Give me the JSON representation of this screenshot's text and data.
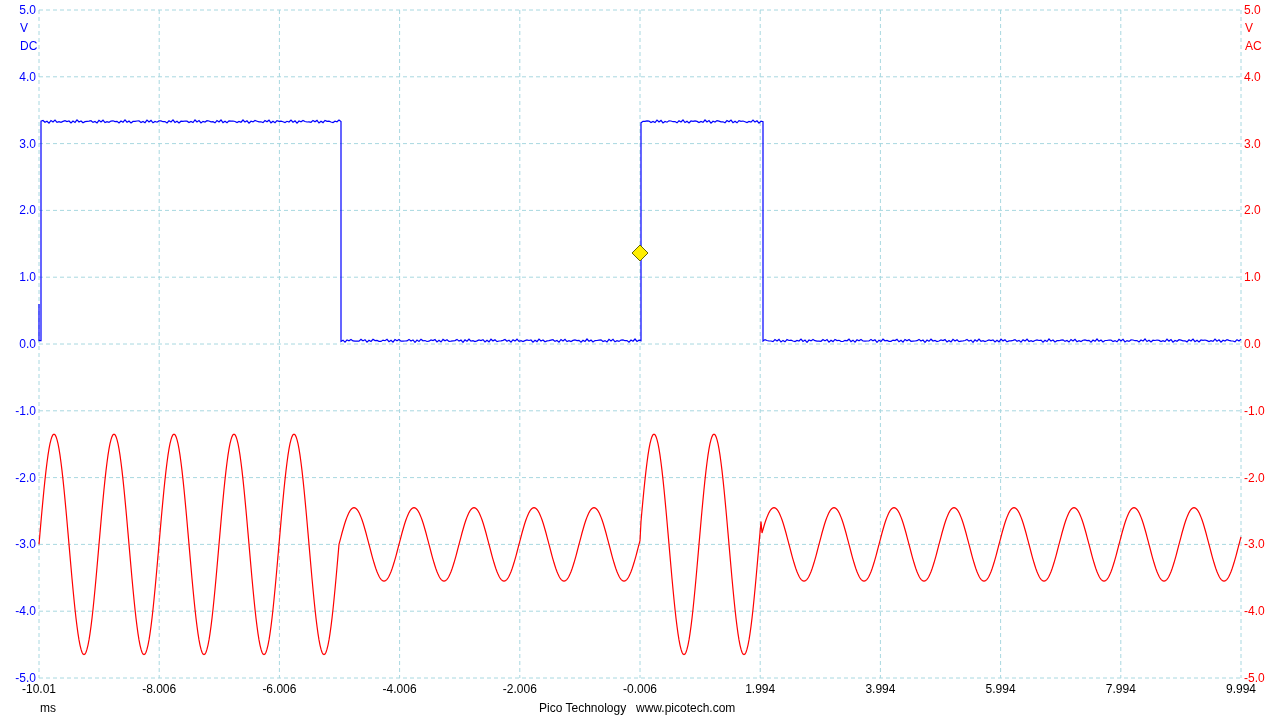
{
  "channels": [
    {
      "kind": "square",
      "color": "#0000ff",
      "unit": "V",
      "coupling": "DC",
      "ticks": [
        "5.0",
        "4.0",
        "3.0",
        "2.0",
        "1.0",
        "0.0",
        "-1.0",
        "-2.0",
        "-3.0",
        "-4.0",
        "-5.0"
      ]
    },
    {
      "kind": "sine",
      "color": "#ff0000",
      "unit": "V",
      "coupling": "AC",
      "ticks": [
        "5.0",
        "4.0",
        "3.0",
        "2.0",
        "1.0",
        "0.0",
        "-1.0",
        "-2.0",
        "-3.0",
        "-4.0",
        "-5.0"
      ]
    }
  ],
  "x_axis": {
    "unit": "ms",
    "ticks": [
      "-10.01",
      "-8.006",
      "-6.006",
      "-4.006",
      "-2.006",
      "-0.006",
      "1.994",
      "3.994",
      "5.994",
      "7.994",
      "9.994"
    ]
  },
  "footer": {
    "company": "Pico Technology",
    "website": "www.picotech.com"
  }
}
